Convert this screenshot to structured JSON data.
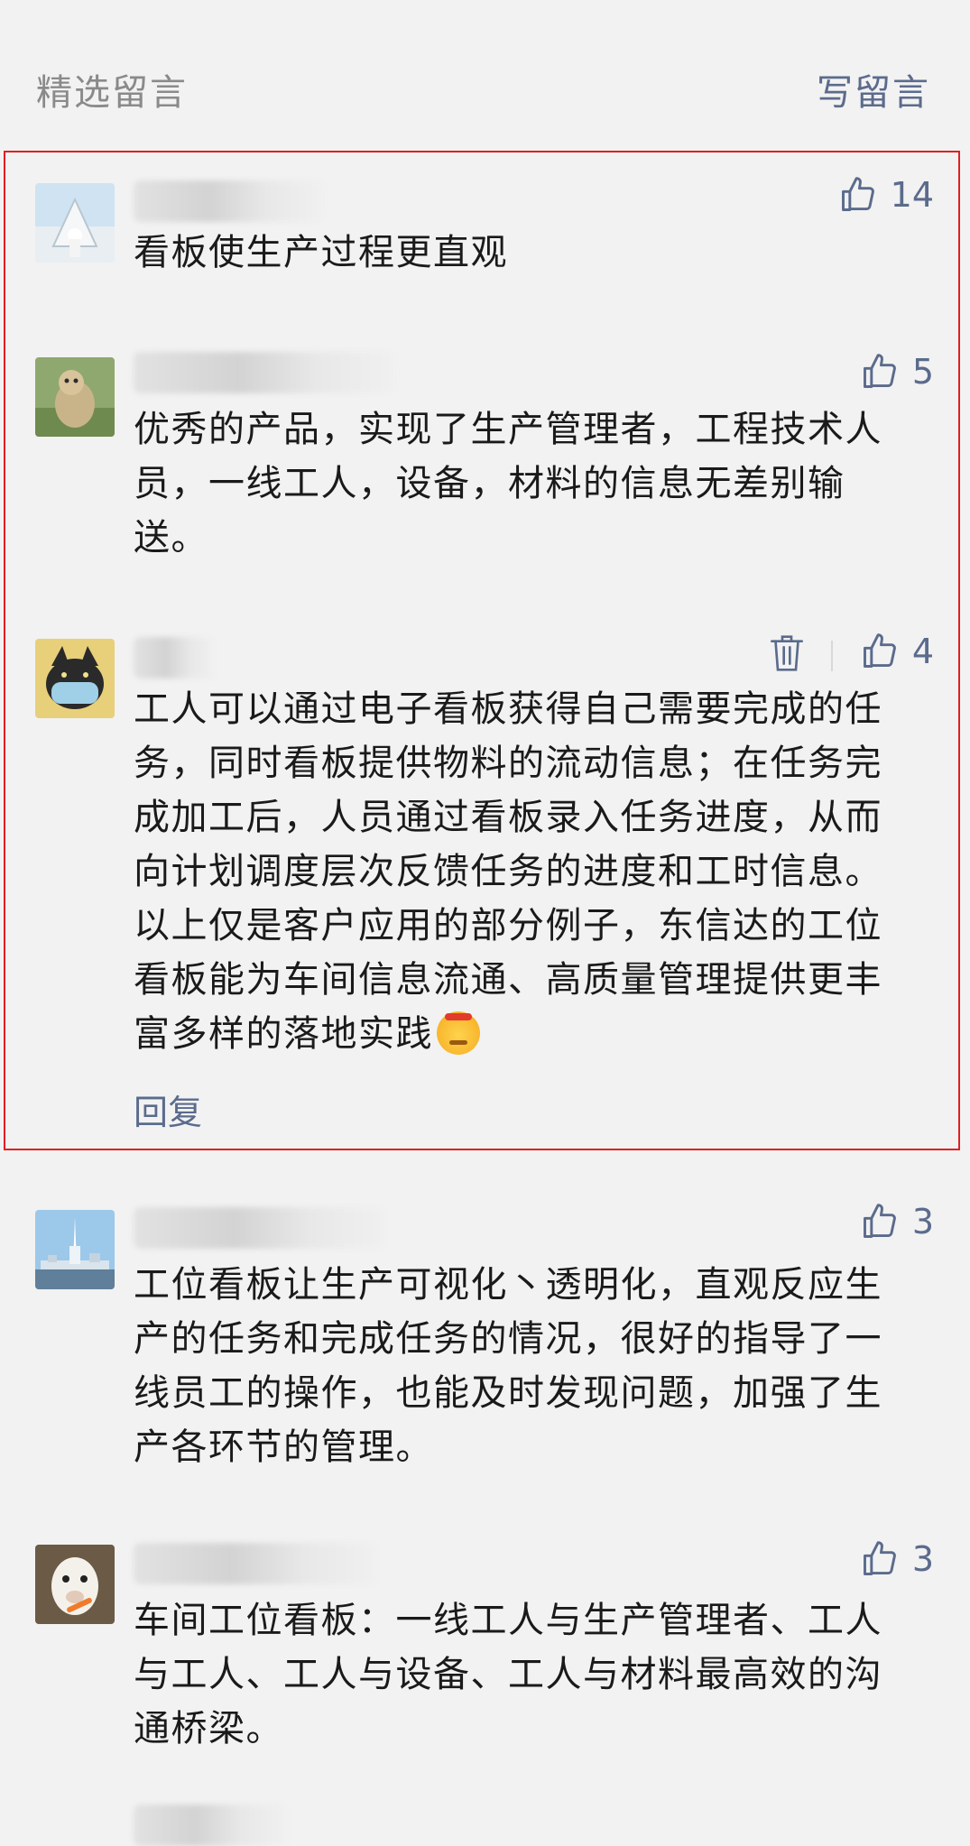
{
  "header": {
    "title": "精选留言",
    "write_label": "写留言"
  },
  "comments": [
    {
      "likes": "14",
      "text": "看板使生产过程更直观"
    },
    {
      "likes": "5",
      "text": "优秀的产品，实现了生产管理者，工程技术人员，一线工人，设备，材料的信息无差别输送。"
    },
    {
      "likes": "4",
      "text": "工人可以通过电子看板获得自己需要完成的任务，同时看板提供物料的流动信息；在任务完成加工后，人员通过看板录入任务进度，从而向计划调度层次反馈任务的进度和工时信息。以上仅是客户应用的部分例子，东信达的工位看板能为车间信息流通、高质量管理提供更丰富多样的落地实践",
      "emoji": "emoji-icon",
      "reply_label": "回复"
    },
    {
      "likes": "3",
      "text": "工位看板让生产可视化丶透明化，直观反应生产的任务和完成任务的情况，很好的指导了一线员工的操作，也能及时发现问题，加强了生产各环节的管理。"
    },
    {
      "likes": "3",
      "text": "车间工位看板：一线工人与生产管理者、工人与工人、工人与设备、工人与材料最高效的沟通桥梁。"
    }
  ],
  "colors": {
    "background": "#f2f2f2",
    "link": "#5b6b8c",
    "highlight_border": "#e02020"
  }
}
